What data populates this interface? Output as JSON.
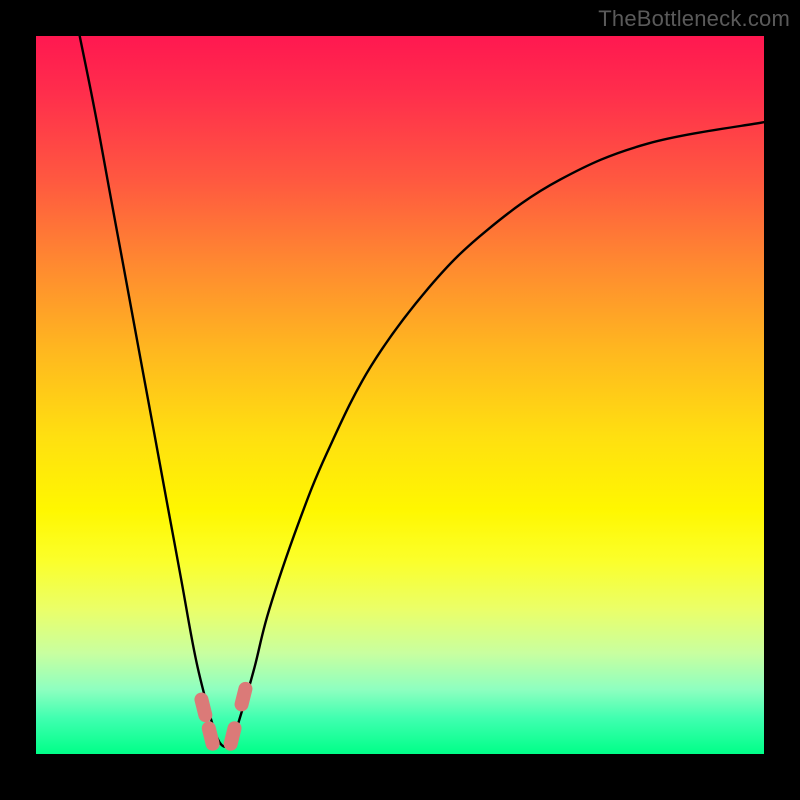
{
  "watermark": "TheBottleneck.com",
  "chart_data": {
    "type": "line",
    "title": "",
    "xlabel": "",
    "ylabel": "",
    "xlim": [
      0,
      100
    ],
    "ylim": [
      0,
      100
    ],
    "series": [
      {
        "name": "bottleneck-curve",
        "x": [
          6,
          8,
          10,
          12,
          14,
          16,
          18,
          20,
          22,
          24,
          25,
          26,
          27,
          28,
          30,
          32,
          36,
          40,
          46,
          54,
          62,
          72,
          84,
          100
        ],
        "y": [
          100,
          90,
          79,
          68,
          57,
          46,
          35,
          24,
          13,
          5,
          2,
          1,
          2,
          5,
          12,
          20,
          32,
          42,
          54,
          65,
          73,
          80,
          85,
          88
        ]
      }
    ],
    "markers": [
      {
        "name": "marker-left-upper",
        "x": 23.0,
        "y": 6.5
      },
      {
        "name": "marker-left-lower",
        "x": 24.0,
        "y": 2.5
      },
      {
        "name": "marker-right-lower",
        "x": 27.0,
        "y": 2.5
      },
      {
        "name": "marker-right-upper",
        "x": 28.5,
        "y": 8.0
      }
    ],
    "gradient_stops": [
      {
        "pos": 0.0,
        "color": "#ff1850"
      },
      {
        "pos": 0.32,
        "color": "#ff8a30"
      },
      {
        "pos": 0.66,
        "color": "#fff700"
      },
      {
        "pos": 1.0,
        "color": "#00ff88"
      }
    ]
  }
}
